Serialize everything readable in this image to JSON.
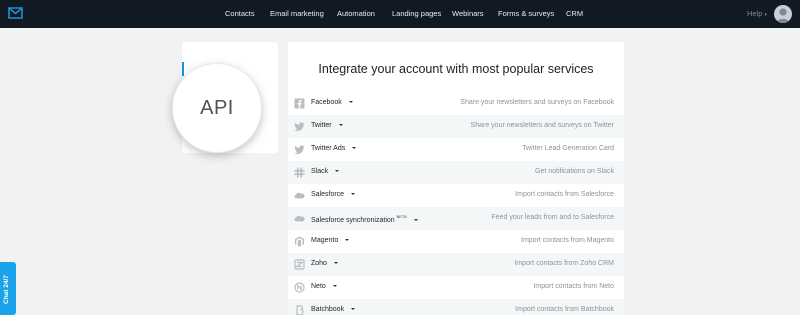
{
  "topbar": {
    "nav": [
      {
        "label": "Contacts"
      },
      {
        "label": "Email marketing"
      },
      {
        "label": "Automation"
      },
      {
        "label": "Landing pages"
      },
      {
        "label": "Webinars"
      },
      {
        "label": "Forms & surveys"
      },
      {
        "label": "CRM"
      }
    ],
    "help_label": "Help",
    "brand_color": "#1e90d6"
  },
  "sidebar": {
    "api_label": "API"
  },
  "main": {
    "title": "Integrate your account with most popular services",
    "integrations": [
      {
        "name": "Facebook",
        "badge": "",
        "description": "Share your newsletters and surveys on Facebook",
        "icon": "facebook-icon"
      },
      {
        "name": "Twitter",
        "badge": "",
        "description": "Share your newsletters and surveys on Twitter",
        "icon": "twitter-icon"
      },
      {
        "name": "Twitter Ads",
        "badge": "",
        "description": "Twitter Lead Generation Card",
        "icon": "twitter-icon"
      },
      {
        "name": "Slack",
        "badge": "",
        "description": "Get notifications on Slack",
        "icon": "slack-icon"
      },
      {
        "name": "Salesforce",
        "badge": "",
        "description": "Import contacts from Salesforce",
        "icon": "salesforce-icon"
      },
      {
        "name": "Salesforce synchronization",
        "badge": "BETA",
        "description": "Feed your leads from and to Salesforce",
        "icon": "salesforce-icon"
      },
      {
        "name": "Magento",
        "badge": "",
        "description": "Import contacts from Magento",
        "icon": "magento-icon"
      },
      {
        "name": "Zoho",
        "badge": "",
        "description": "Import contacts from Zoho CRM",
        "icon": "zoho-icon"
      },
      {
        "name": "Neto",
        "badge": "",
        "description": "Import contacts from Neto",
        "icon": "neto-icon"
      },
      {
        "name": "Batchbook",
        "badge": "",
        "description": "Import contacts from Batchbook",
        "icon": "batchbook-icon"
      }
    ]
  },
  "chat": {
    "label": "Chat 24/7",
    "color": "#1aa3e8"
  }
}
